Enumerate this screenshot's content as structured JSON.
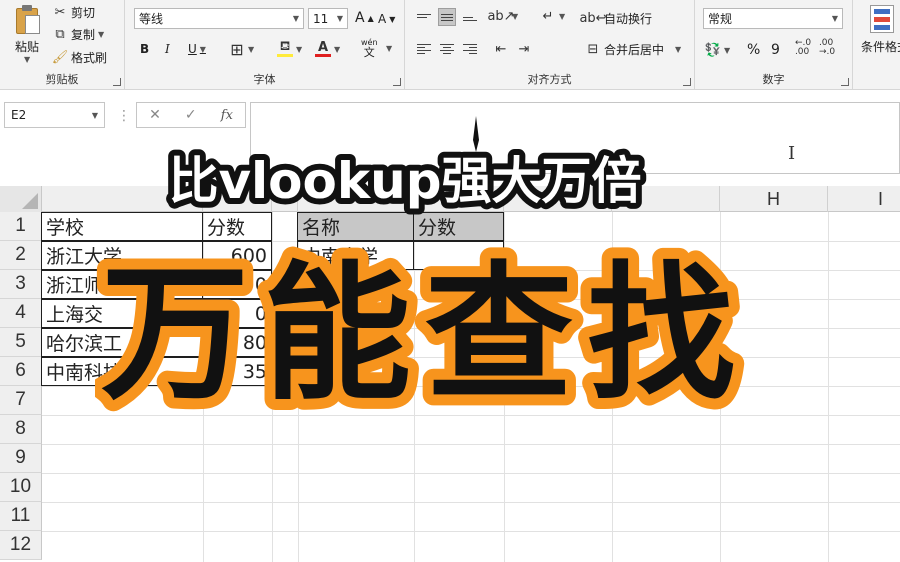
{
  "ribbon": {
    "clipboard": {
      "paste_label": "粘贴",
      "cut_label": "剪切",
      "copy_label": "复制",
      "format_painter_label": "格式刷",
      "group_label": "剪贴板"
    },
    "font": {
      "font_name": "等线",
      "font_size": "11",
      "bold": "B",
      "italic": "I",
      "underline": "U",
      "grow": "A",
      "shrink": "A",
      "font_color_glyph": "A",
      "phonetic_label": "wén",
      "phonetic_glyph": "文",
      "group_label": "字体"
    },
    "alignment": {
      "wrap_text_label": "自动换行",
      "merge_center_label": "合并后居中",
      "group_label": "对齐方式"
    },
    "number": {
      "format_value": "常规",
      "percent_glyph": "%",
      "comma_glyph": "9",
      "inc_decimal": "←.0\n.00",
      "group_label": "数字"
    },
    "styles": {
      "conditional_format_label": "条件格式"
    }
  },
  "formula_bar": {
    "name_box": "E2",
    "cancel_glyph": "✕",
    "enter_glyph": "✓",
    "fx_label": "fx",
    "formula": ""
  },
  "sheet": {
    "columns": [
      {
        "letter": ""
      },
      {
        "letter": ""
      },
      {
        "letter": ""
      },
      {
        "letter": ""
      },
      {
        "letter": ""
      },
      {
        "letter": ""
      },
      {
        "letter": ""
      },
      {
        "letter": "H"
      },
      {
        "letter": "I"
      }
    ],
    "rows": [
      "1",
      "2",
      "3",
      "4",
      "5",
      "6",
      "7",
      "8",
      "9",
      "10",
      "11",
      "12"
    ],
    "table_left": {
      "header": [
        "学校",
        "分数"
      ],
      "rows": [
        [
          "浙江大学",
          "600"
        ],
        [
          "浙江师",
          "0"
        ],
        [
          "上海交",
          "0"
        ],
        [
          "哈尔滨工",
          "80"
        ],
        [
          "中南科技",
          "35"
        ]
      ]
    },
    "table_right": {
      "header": [
        "名称",
        "分数"
      ],
      "rows": [
        [
          "中南大学",
          ""
        ]
      ]
    }
  },
  "overlay": {
    "title_top": "比vlookup强大万倍",
    "title_main": "万能查找",
    "colors": {
      "outline_orange": "#f7941d",
      "text_black": "#111111",
      "text_white": "#ffffff"
    }
  }
}
